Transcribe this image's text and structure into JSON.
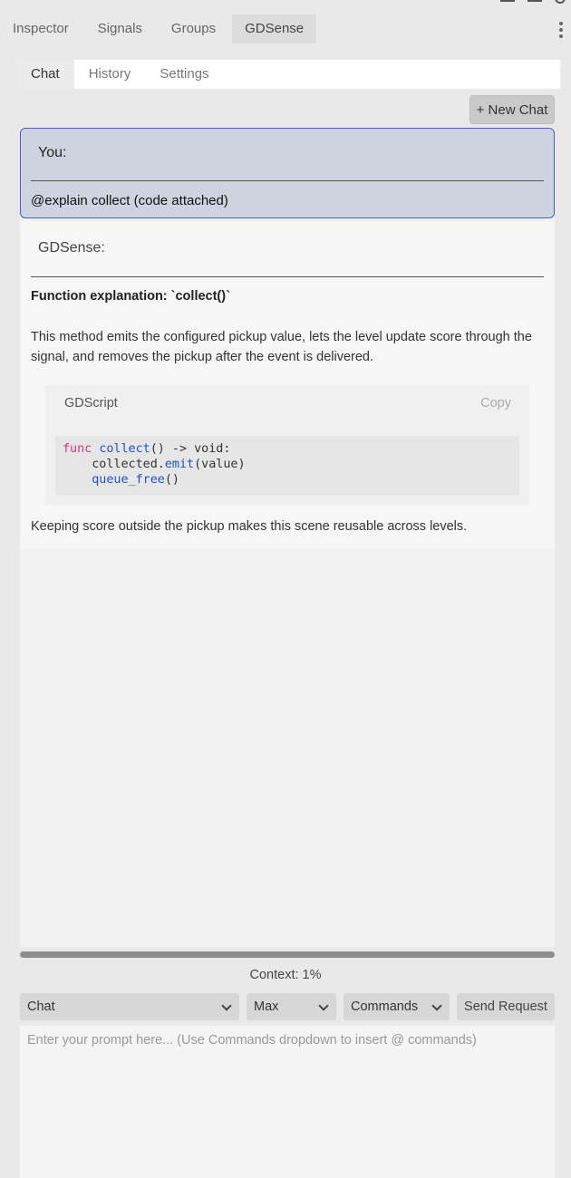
{
  "dock_tabs": [
    {
      "label": "Inspector"
    },
    {
      "label": "Signals"
    },
    {
      "label": "Groups"
    },
    {
      "label": "GDSense"
    }
  ],
  "sub_tabs": [
    {
      "label": "Chat"
    },
    {
      "label": "History"
    },
    {
      "label": "Settings"
    }
  ],
  "new_chat_label": "+ New Chat",
  "user_message": {
    "who": "You:",
    "text": "@explain collect (code attached)"
  },
  "ai_message": {
    "who": "GDSense:",
    "heading": "Function explanation: `collect()`",
    "paragraph": "This method emits the configured pickup value, lets the level update score through the signal, and removes the pickup after the event is delivered.",
    "code_lang": "GDScript",
    "copy_label": "Copy",
    "code_lines": [
      "func collect() -> void:",
      "    collected.emit(value)",
      "    queue_free()"
    ],
    "footer": "Keeping score outside the pickup makes this scene reusable across levels."
  },
  "context_label": "Context: 1%",
  "mode_select": "Chat",
  "effort_select": "Max",
  "commands_select": "Commands",
  "send_label": "Send Request",
  "prompt_placeholder": "Enter your prompt here... (Use Commands dropdown to insert @ commands)",
  "colors": {
    "user_bubble": "#cfd3df",
    "user_border": "#3f63c9",
    "keyword": "#d1357a",
    "function": "#2250c8"
  }
}
